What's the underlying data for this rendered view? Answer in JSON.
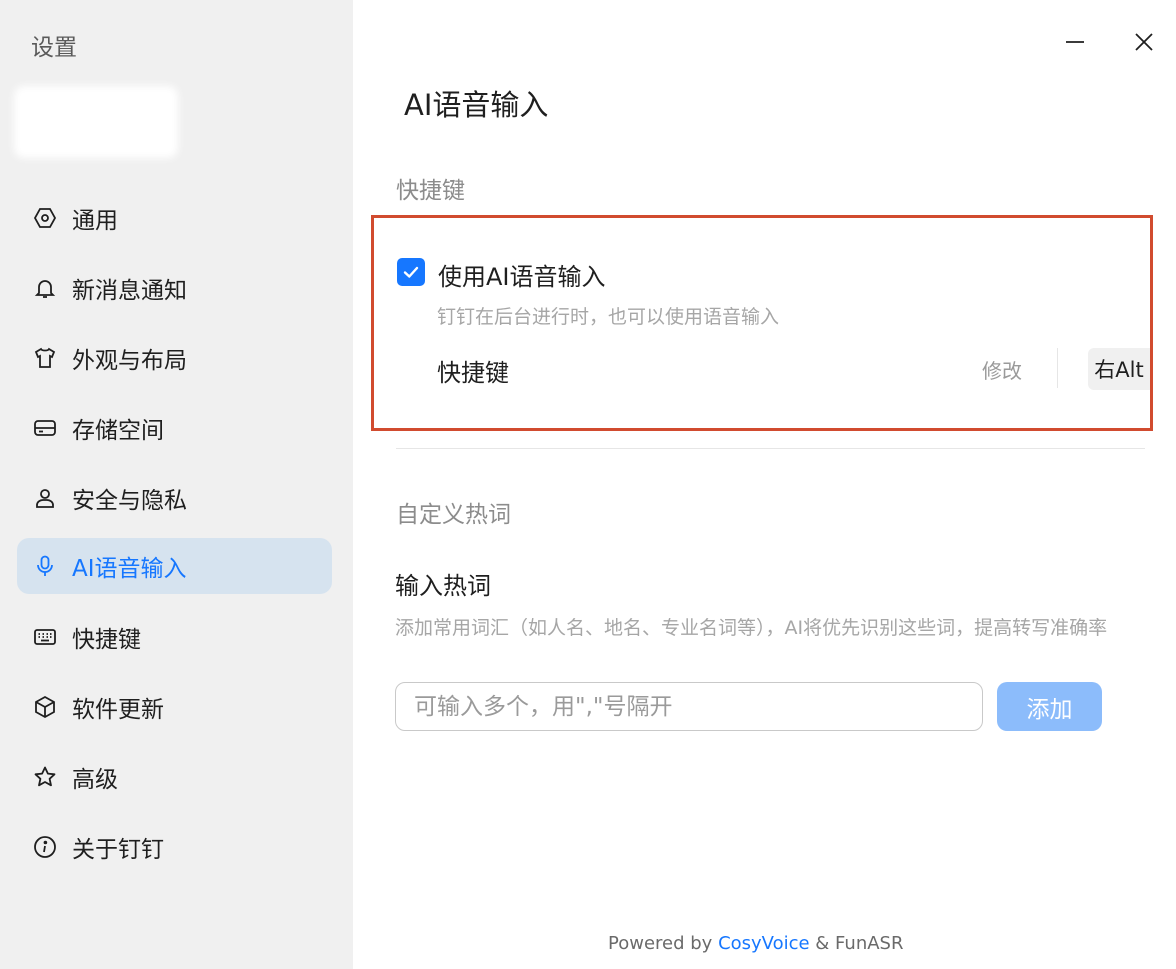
{
  "sidebar": {
    "title": "设置",
    "items": [
      {
        "label": "通用",
        "icon": "hexagon-settings-icon"
      },
      {
        "label": "新消息通知",
        "icon": "bell-icon"
      },
      {
        "label": "外观与布局",
        "icon": "tshirt-icon"
      },
      {
        "label": "存储空间",
        "icon": "hard-drive-icon"
      },
      {
        "label": "安全与隐私",
        "icon": "user-icon"
      },
      {
        "label": "AI语音输入",
        "icon": "microphone-icon",
        "active": true
      },
      {
        "label": "快捷键",
        "icon": "keyboard-icon"
      },
      {
        "label": "软件更新",
        "icon": "cube-icon"
      },
      {
        "label": "高级",
        "icon": "star-icon"
      },
      {
        "label": "关于钉钉",
        "icon": "info-icon"
      }
    ]
  },
  "window": {
    "minimize_icon": "minimize-icon",
    "close_icon": "close-icon"
  },
  "main": {
    "title": "AI语音输入",
    "shortcut_section": {
      "label": "快捷键",
      "checkbox_label": "使用AI语音输入",
      "checkbox_checked": true,
      "description": "钉钉在后台进行时，也可以使用语音输入",
      "shortcut_label": "快捷键",
      "modify_label": "修改",
      "key_value": "右Alt"
    },
    "hotword_section": {
      "label": "自定义热词",
      "title": "输入热词",
      "description": "添加常用词汇（如人名、地名、专业名词等），AI将优先识别这些词，提高转写准确率",
      "input_placeholder": "可输入多个，用\",\"号隔开",
      "input_value": "",
      "add_button_label": "添加"
    }
  },
  "footer": {
    "prefix": "Powered by ",
    "brand": "CosyVoice",
    "suffix": " & FunASR"
  },
  "colors": {
    "accent": "#1677ff",
    "highlight_border": "#d14b2f",
    "sidebar_bg": "#f0f0f0",
    "active_item_bg": "#d6e3ef"
  }
}
